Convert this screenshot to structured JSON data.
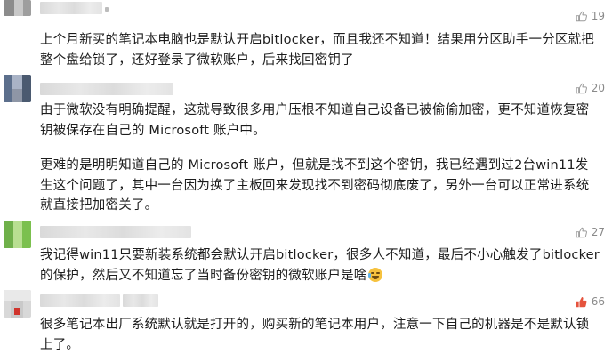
{
  "comments": [
    {
      "likes": "19",
      "text": "上个月新买的笔记本电脑也是默认开启bitlocker，而且我还不知道！结果用分区助手一分区就把整个盘给锁了，还好登录了微软账户，后来找回密钥了"
    },
    {
      "likes": "20",
      "paragraphs": [
        "由于微软没有明确提醒，这就导致很多用户压根不知道自己设备已被偷偷加密，更不知道恢复密钥被保存在自己的 Microsoft 账户中。",
        "更难的是明明知道自己的 Microsoft 账户，但就是找不到这个密钥，我已经遇到过2台win11发生这个问题了，其中一台因为换了主板回来发现找不到密码彻底废了，另外一台可以正常进系统就直接把加密关了。"
      ]
    },
    {
      "likes": "27",
      "text": "我记得win11只要新装系统都会默认开启bitlocker，很多人不知道，最后不小心触发了bitlocker的保护，然后又不知道忘了当时备份密钥的微软账户是啥",
      "emoji": "grinning-sweat-emoji"
    },
    {
      "likes": "66",
      "hot": true,
      "text": "很多笔记本出厂系统默认就是打开的，购买新的笔记本用户，注意一下自己的机器是不是默认锁上了。"
    }
  ],
  "colors": {
    "like_icon": "#9a9a9a",
    "like_icon_hot": "#e5533d",
    "text": "#1c1c1c"
  }
}
